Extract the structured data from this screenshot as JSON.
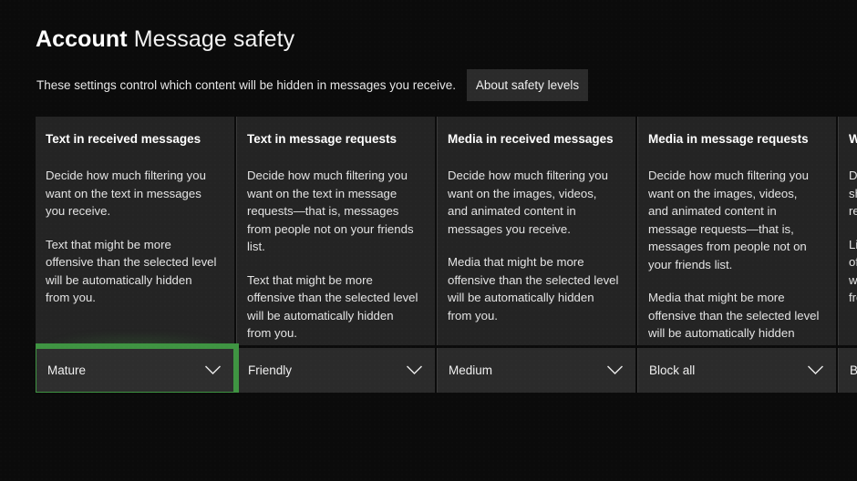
{
  "header": {
    "title_bold": "Account",
    "title_regular": "Message safety",
    "subtitle": "These settings control which content will be hidden in messages you receive.",
    "about_button": "About safety levels",
    "chevron_icon": "chevron-down-icon"
  },
  "accent": {
    "focus_green": "#3f9442",
    "panel_bg": "#242424",
    "select_bg": "#2b2b2b",
    "page_bg": "#0b0b0b"
  },
  "columns": [
    {
      "title": "Text in received messages",
      "paragraphs": [
        "Decide how much filtering you want on the text in messages you receive.",
        "Text that might be more offensive than the selected level will be automatically hidden from you."
      ],
      "selected": "Mature",
      "focused": true
    },
    {
      "title": "Text in message requests",
      "paragraphs": [
        "Decide how much filtering you want on the text in message requests—that is, messages from people not on your friends list.",
        "Text that might be more offensive than the selected level will be automatically hidden from you."
      ],
      "selected": "Friendly",
      "focused": false
    },
    {
      "title": "Media in received messages",
      "paragraphs": [
        "Decide how much filtering you want on the images, videos, and animated content in messages you receive.",
        "Media that might be more offensive than the selected level will be automatically hidden from you."
      ],
      "selected": "Medium",
      "focused": false
    },
    {
      "title": "Media in message requests",
      "paragraphs": [
        "Decide how much filtering you want on the images, videos, and animated content in message requests—that is, messages from people not on your friends list.",
        "Media that might be more offensive than the selected level will be automatically hidden from you."
      ],
      "selected": "Block all",
      "focused": false
    },
    {
      "title": "Web links",
      "paragraphs": [
        "Decide whether web links are shown in messages you receive.",
        "Links that might be more offensive than the selected level will be automatically hidden from you."
      ],
      "selected": "Block all",
      "focused": false
    }
  ]
}
